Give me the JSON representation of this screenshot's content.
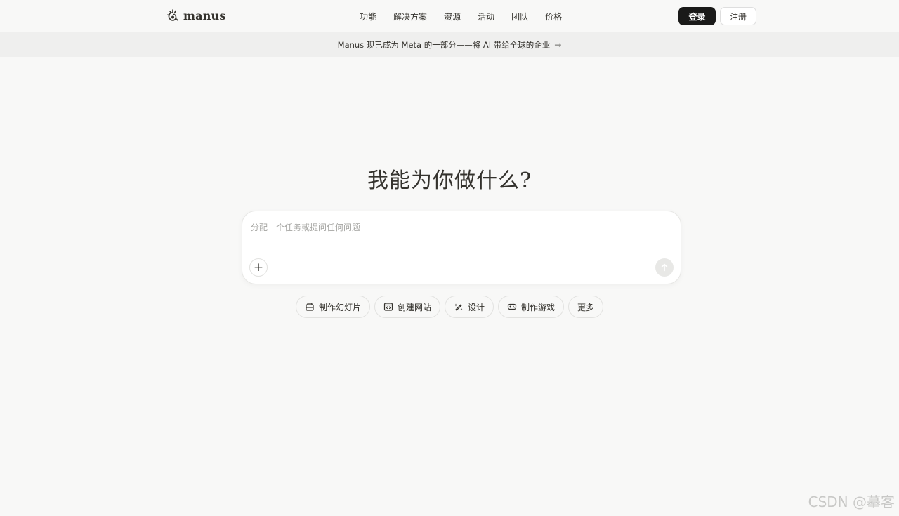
{
  "header": {
    "logo_text": "manus",
    "nav": [
      "功能",
      "解决方案",
      "资源",
      "活动",
      "团队",
      "价格"
    ],
    "login_label": "登录",
    "signup_label": "注册"
  },
  "banner": {
    "text": "Manus 现已成为 Meta 的一部分——将 AI 带给全球的企业",
    "arrow": "→"
  },
  "hero": {
    "title": "我能为你做什么?"
  },
  "composer": {
    "placeholder": "分配一个任务或提问任何问题",
    "value": "",
    "plus_label": "+"
  },
  "chips": [
    {
      "label": "制作幻灯片",
      "icon": "slides-icon"
    },
    {
      "label": "创建网站",
      "icon": "website-icon"
    },
    {
      "label": "设计",
      "icon": "design-icon"
    },
    {
      "label": "制作游戏",
      "icon": "gamepad-icon"
    },
    {
      "label": "更多",
      "icon": ""
    }
  ],
  "watermark": "CSDN @摹客",
  "colors": {
    "background": "#f8f8f7",
    "banner": "#efefee",
    "primary_button": "#1a1a19",
    "text": "#34322d"
  }
}
